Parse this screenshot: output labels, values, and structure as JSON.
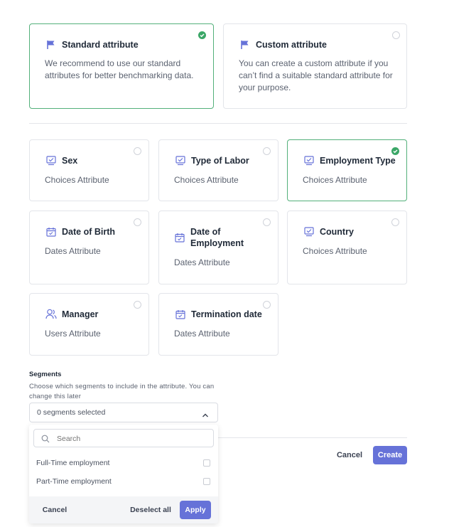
{
  "attribute_types": [
    {
      "title": "Standard attribute",
      "description": "We recommend to use our standard attributes for better benchmarking data.",
      "selected": true,
      "icon": "flag-icon"
    },
    {
      "title": "Custom attribute",
      "description": "You can create a custom attribute if you can’t find a suitable standard attribute for your purpose.",
      "selected": false,
      "icon": "flag-icon"
    }
  ],
  "attributes": [
    {
      "title": "Sex",
      "type": "Choices Attribute",
      "selected": false,
      "icon": "choices-icon"
    },
    {
      "title": "Type of Labor",
      "type": "Choices Attribute",
      "selected": false,
      "icon": "choices-icon"
    },
    {
      "title": "Employment Type",
      "type": "Choices Attribute",
      "selected": true,
      "icon": "choices-icon"
    },
    {
      "title": "Date of Birth",
      "type": "Dates Attribute",
      "selected": false,
      "icon": "calendar-icon"
    },
    {
      "title": "Date of Employment",
      "type": "Dates Attribute",
      "selected": false,
      "icon": "calendar-icon"
    },
    {
      "title": "Country",
      "type": "Choices Attribute",
      "selected": false,
      "icon": "choices-icon"
    },
    {
      "title": "Manager",
      "type": "Users Attribute",
      "selected": false,
      "icon": "users-icon"
    },
    {
      "title": "Termination date",
      "type": "Dates Attribute",
      "selected": false,
      "icon": "calendar-icon"
    }
  ],
  "segments": {
    "label": "Segments",
    "help": "Choose which segments to include in the attribute. You can change this later",
    "selected_text": "0 segments selected",
    "search_placeholder": "Search",
    "options": [
      {
        "label": "Full-Time employment",
        "checked": false
      },
      {
        "label": "Part-Time employment",
        "checked": false
      }
    ],
    "cancel_label": "Cancel",
    "deselect_label": "Deselect all",
    "apply_label": "Apply"
  },
  "footer": {
    "cancel_label": "Cancel",
    "create_label": "Create"
  },
  "colors": {
    "accent": "#6672d8",
    "selected_border": "#53b07a",
    "check_green": "#3ba767"
  }
}
